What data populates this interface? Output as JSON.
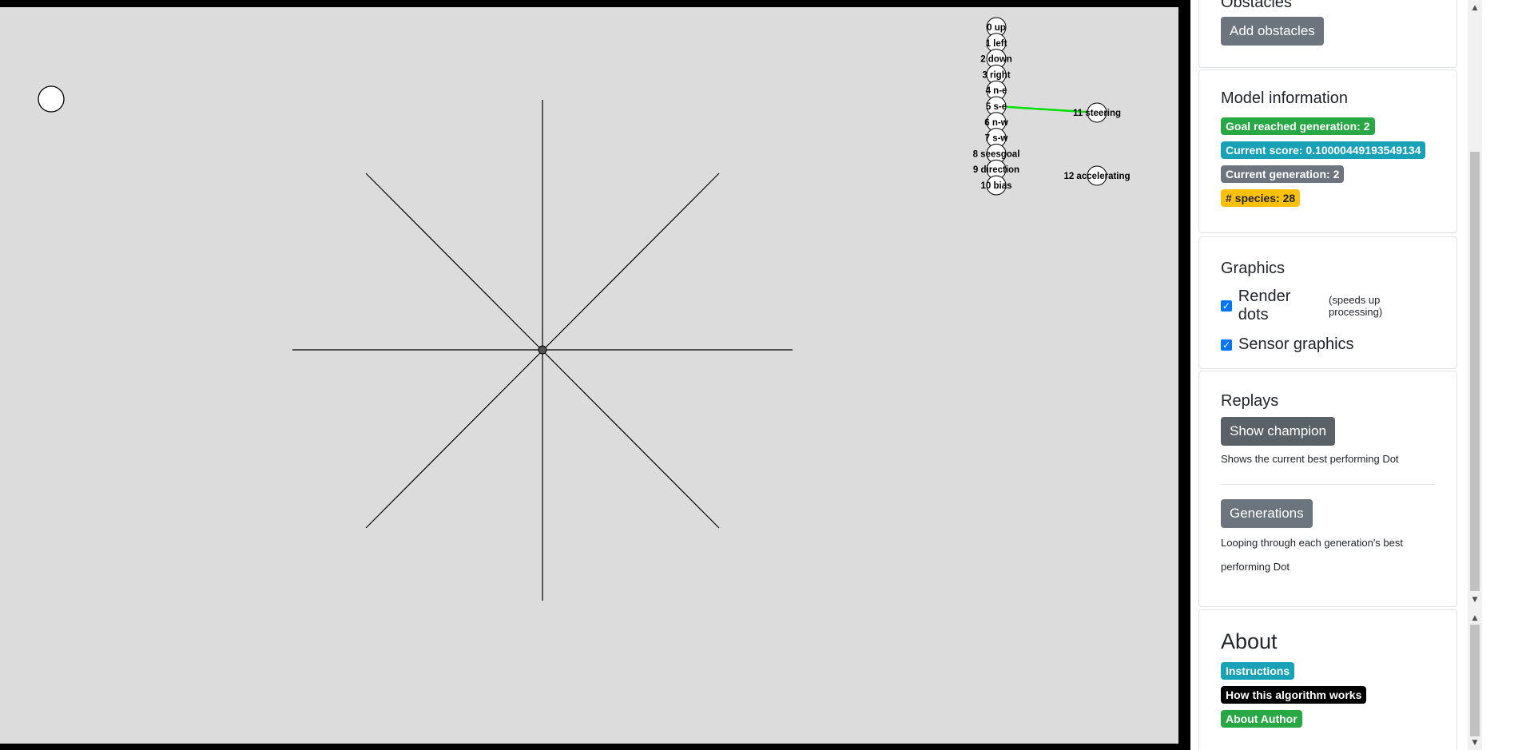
{
  "sidebar": {
    "obstacles": {
      "title": "Obstacles",
      "add_button": "Add obstacles"
    },
    "model_info": {
      "title": "Model information",
      "goal_reached": "Goal reached generation: 2",
      "current_score": "Current score: 0.10000449193549134",
      "current_generation": "Current generation: 2",
      "species": "# species: 28",
      "colors": {
        "goal_reached": "#28a745",
        "current_score": "#17a2b8",
        "current_generation": "#6c757d",
        "species": "#ffc107"
      }
    },
    "graphics": {
      "title": "Graphics",
      "render_dots_label": "Render dots",
      "render_dots_note": "(speeds up processing)",
      "render_dots_checked": true,
      "sensor_graphics_label": "Sensor graphics",
      "sensor_graphics_checked": true
    },
    "replays": {
      "title": "Replays",
      "show_champion_button": "Show champion",
      "show_champion_help": "Shows the current best performing Dot",
      "generations_button": "Generations",
      "generations_help_line1": "Looping through each generation's best",
      "generations_help_line2": "performing Dot"
    },
    "about": {
      "title": "About",
      "instructions": "Instructions",
      "how_it_works": "How this algorithm works",
      "about_author": "About Author",
      "colors": {
        "instructions": "#17a2b8",
        "how_it_works": "#000000",
        "about_author": "#28a745"
      }
    }
  },
  "network": {
    "input_nodes": [
      "0 up",
      "1 left",
      "2 down",
      "3 right",
      "4 n-e",
      "5 s-e",
      "6 n-w",
      "7 s-w",
      "8 seesgoal",
      "9 direction",
      "10 bias"
    ],
    "output_nodes": [
      "11 steering",
      "12 accelerating"
    ],
    "active_connection": {
      "from": "5 s-e",
      "to": "11 steering",
      "color": "#00e000"
    }
  },
  "colors": {
    "canvas_background": "#dcdcdc",
    "frame": "#000000",
    "accent_checkbox": "#0075ff"
  }
}
